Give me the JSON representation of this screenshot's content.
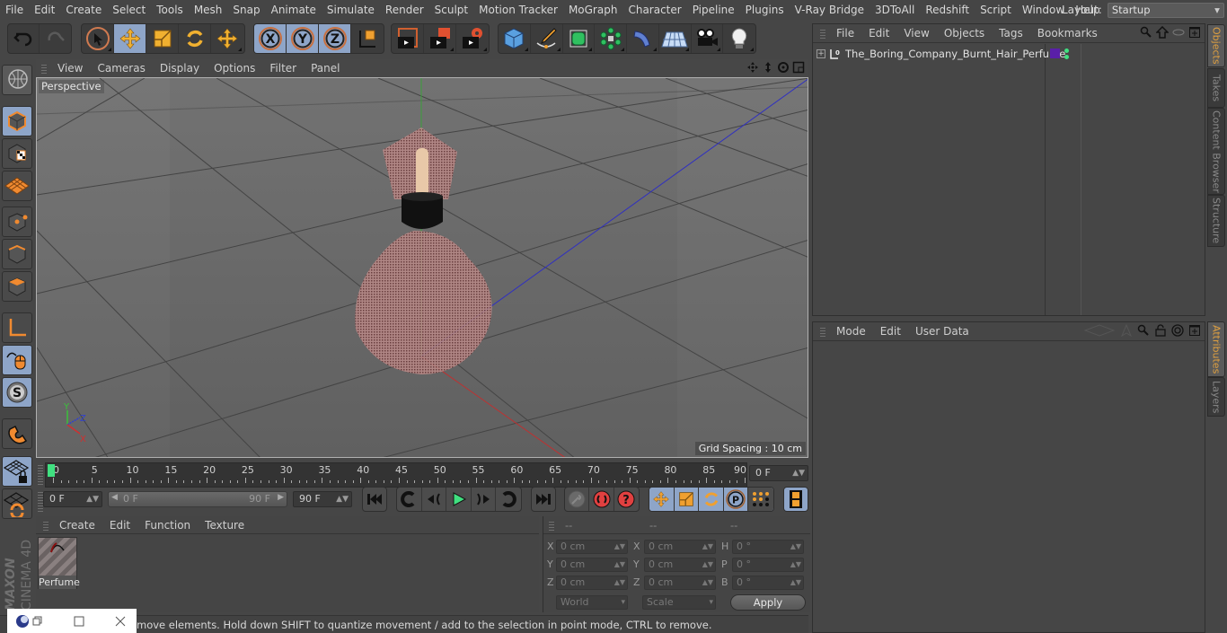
{
  "menu": [
    "File",
    "Edit",
    "Create",
    "Select",
    "Tools",
    "Mesh",
    "Snap",
    "Animate",
    "Simulate",
    "Render",
    "Sculpt",
    "Motion Tracker",
    "MoGraph",
    "Character",
    "Pipeline",
    "Plugins",
    "V-Ray Bridge",
    "3DToAll",
    "Redshift",
    "Script",
    "Window",
    "Help"
  ],
  "layout": {
    "label": "Layout:",
    "value": "Startup"
  },
  "viewport": {
    "menu": [
      "View",
      "Cameras",
      "Display",
      "Options",
      "Filter",
      "Panel"
    ],
    "camera_label": "Perspective",
    "grid_spacing": "Grid Spacing : 10 cm",
    "axis_labels": {
      "x": "X",
      "y": "Y",
      "z": "Z"
    }
  },
  "timeline": {
    "ticks": [
      "0",
      "5",
      "10",
      "15",
      "20",
      "25",
      "30",
      "35",
      "40",
      "45",
      "50",
      "55",
      "60",
      "65",
      "70",
      "75",
      "80",
      "85",
      "90"
    ],
    "current_frame_display": "0 F",
    "start_field": "0 F",
    "range_start": "0 F",
    "range_end": "90 F",
    "end_field": "90 F"
  },
  "material_panel": {
    "menu": [
      "Create",
      "Edit",
      "Function",
      "Texture"
    ],
    "materials": [
      {
        "name": "Perfume"
      }
    ]
  },
  "coordinates": {
    "headers": [
      "--",
      "--",
      "--"
    ],
    "rows": [
      {
        "l1": "X",
        "v1": "0 cm",
        "l2": "X",
        "v2": "0 cm",
        "l3": "H",
        "v3": "0 °"
      },
      {
        "l1": "Y",
        "v1": "0 cm",
        "l2": "Y",
        "v2": "0 cm",
        "l3": "P",
        "v3": "0 °"
      },
      {
        "l1": "Z",
        "v1": "0 cm",
        "l2": "Z",
        "v2": "0 cm",
        "l3": "B",
        "v3": "0 °"
      }
    ],
    "coord_system": "World",
    "mode": "Scale",
    "apply_label": "Apply"
  },
  "status_text": "move elements. Hold down SHIFT to quantize movement / add to the selection in point mode, CTRL to remove.",
  "object_manager": {
    "menu": [
      "File",
      "Edit",
      "View",
      "Objects",
      "Tags",
      "Bookmarks"
    ],
    "objects": [
      {
        "name": "The_Boring_Company_Burnt_Hair_Perfume",
        "layer_color": "#5a1fa8"
      }
    ]
  },
  "attribute_manager": {
    "menu": [
      "Mode",
      "Edit",
      "User Data"
    ]
  },
  "side_tabs_top": [
    "Objects",
    "Takes",
    "Content Browser",
    "Structure"
  ],
  "side_tabs_bottom": [
    "Attributes",
    "Layers"
  ],
  "brand": {
    "line1": "MAXON",
    "line2": "CINEMA 4D"
  },
  "colors": {
    "accent_blue": "#8ea5c8",
    "orange": "#f0a030",
    "active_tab": "#e0a040"
  }
}
